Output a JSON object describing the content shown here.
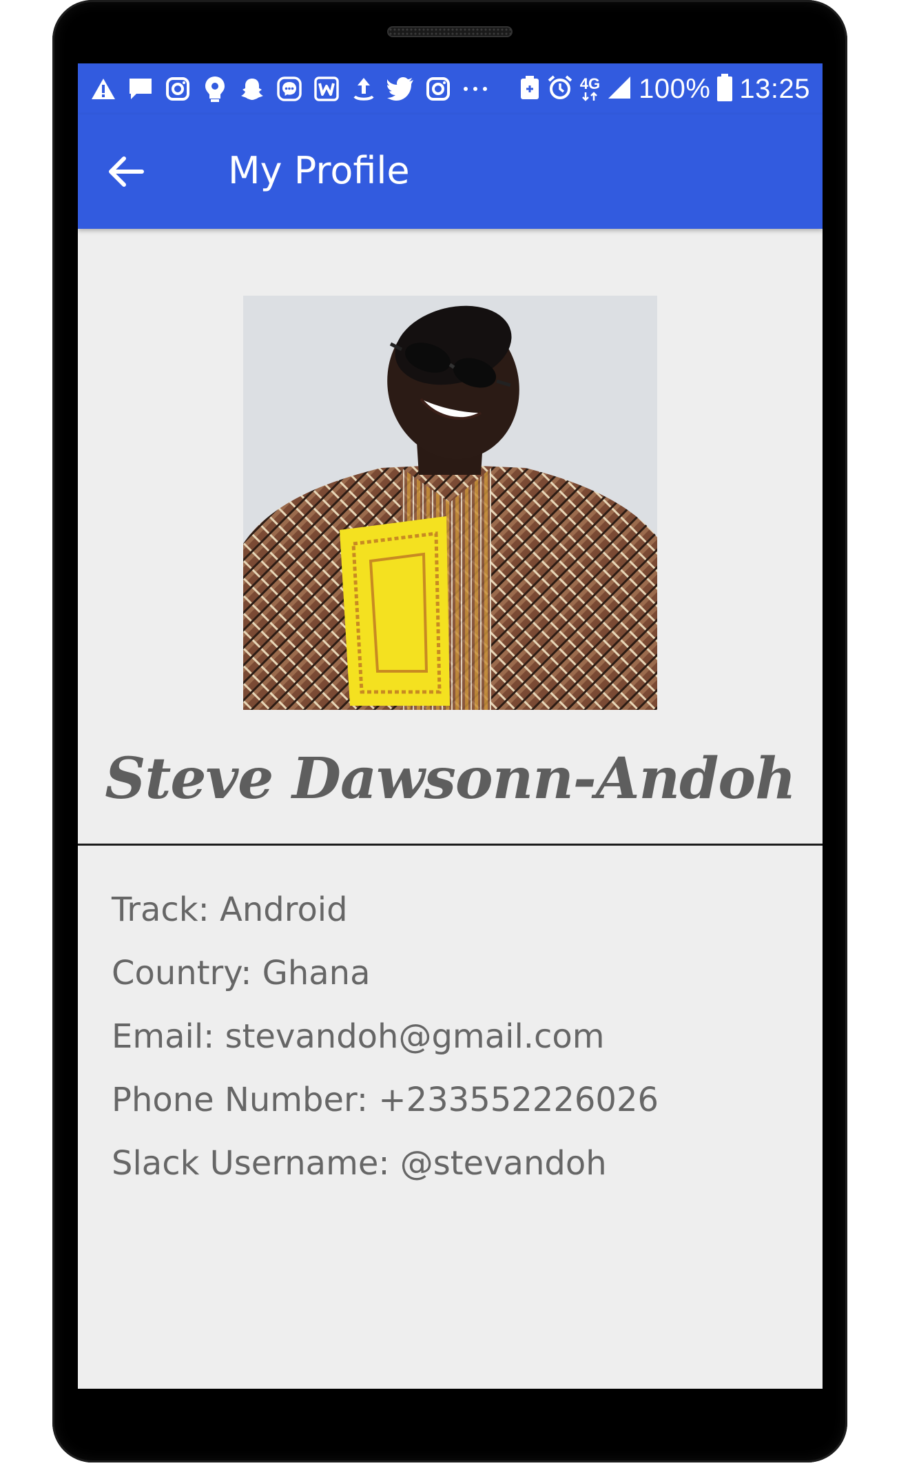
{
  "status_bar": {
    "network": "4G",
    "battery": "100%",
    "time": "13:25",
    "left_icons": [
      "warning-icon",
      "message-icon",
      "instagram-icon",
      "lightbulb-icon",
      "snapchat-icon",
      "messenger-icon",
      "word-icon",
      "upload-icon",
      "twitter-icon",
      "instagram-icon",
      "more-icon"
    ],
    "right_icons": [
      "battery-saver-icon",
      "alarm-icon",
      "network-4g-icon",
      "signal-icon",
      "battery-icon"
    ]
  },
  "app_bar": {
    "title": "My Profile",
    "back_icon": "arrow-left-icon"
  },
  "profile": {
    "name": "Steve Dawsonn-Andoh",
    "details": [
      "Track: Android",
      "Country: Ghana",
      "Email: stevandoh@gmail.com",
      "Phone Number: +233552226026",
      "Slack Username: @stevandoh"
    ]
  },
  "colors": {
    "primary": "#325bdf",
    "background": "#eeeeee",
    "name_text": "#5e5e5e",
    "detail_text": "#666666"
  }
}
